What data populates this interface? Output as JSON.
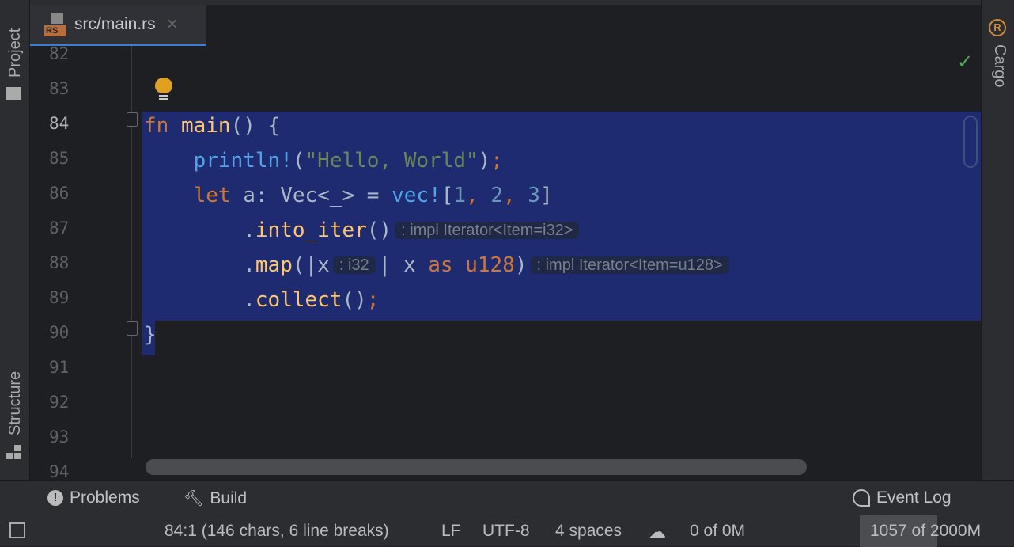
{
  "left_toolbar": {
    "project": "Project",
    "structure": "Structure"
  },
  "right_toolbar": {
    "cargo": "Cargo"
  },
  "tab": {
    "file_badge": "RS",
    "title": "src/main.rs",
    "close": "×"
  },
  "editor": {
    "line_numbers": [
      "82",
      "83",
      "84",
      "85",
      "86",
      "87",
      "88",
      "89",
      "90",
      "91",
      "92",
      "93",
      "94"
    ],
    "current_line": "84",
    "code_lines": [
      [
        {
          "c": "kw",
          "t": "fn "
        },
        {
          "c": "fn",
          "t": "main"
        },
        {
          "c": "pun",
          "t": "() {"
        }
      ],
      [
        {
          "c": "pun",
          "t": "    "
        },
        {
          "c": "mac",
          "t": "println!"
        },
        {
          "c": "pun",
          "t": "("
        },
        {
          "c": "str",
          "t": "\"Hello, World\""
        },
        {
          "c": "pun",
          "t": ")"
        },
        {
          "c": "kw",
          "t": ";"
        }
      ],
      [
        {
          "c": "kw",
          "t": "    let "
        },
        {
          "c": "pun",
          "t": "a: Vec<_> = "
        },
        {
          "c": "mac",
          "t": "vec!"
        },
        {
          "c": "pun",
          "t": "["
        },
        {
          "c": "num",
          "t": "1"
        },
        {
          "c": "kw",
          "t": ", "
        },
        {
          "c": "num",
          "t": "2"
        },
        {
          "c": "kw",
          "t": ", "
        },
        {
          "c": "num",
          "t": "3"
        },
        {
          "c": "pun",
          "t": "]"
        }
      ],
      [
        {
          "c": "pun",
          "t": "        ."
        },
        {
          "c": "fn",
          "t": "into_iter"
        },
        {
          "c": "pun",
          "t": "()"
        },
        {
          "c": "hint",
          "t": ": impl Iterator<Item=i32>"
        }
      ],
      [
        {
          "c": "pun",
          "t": "        ."
        },
        {
          "c": "fn",
          "t": "map"
        },
        {
          "c": "pun",
          "t": "(|x"
        },
        {
          "c": "hint",
          "t": ": i32"
        },
        {
          "c": "pun",
          "t": "| x "
        },
        {
          "c": "kw",
          "t": "as u128"
        },
        {
          "c": "pun",
          "t": ")"
        },
        {
          "c": "hint",
          "t": ": impl Iterator<Item=u128>"
        }
      ],
      [
        {
          "c": "pun",
          "t": "        ."
        },
        {
          "c": "fn",
          "t": "collect"
        },
        {
          "c": "pun",
          "t": "()"
        },
        {
          "c": "kw",
          "t": ";"
        }
      ],
      [
        {
          "c": "pun",
          "t": "}"
        }
      ]
    ]
  },
  "bottom_tools": {
    "problems": "Problems",
    "build": "Build",
    "event_log": "Event Log"
  },
  "status": {
    "position": "84:1 (146 chars, 6 line breaks)",
    "line_sep": "LF",
    "encoding": "UTF-8",
    "indent": "4 spaces",
    "vcs": "0 of 0M",
    "memory": "1057 of 2000M",
    "memory_used_fraction": 0.5285
  }
}
